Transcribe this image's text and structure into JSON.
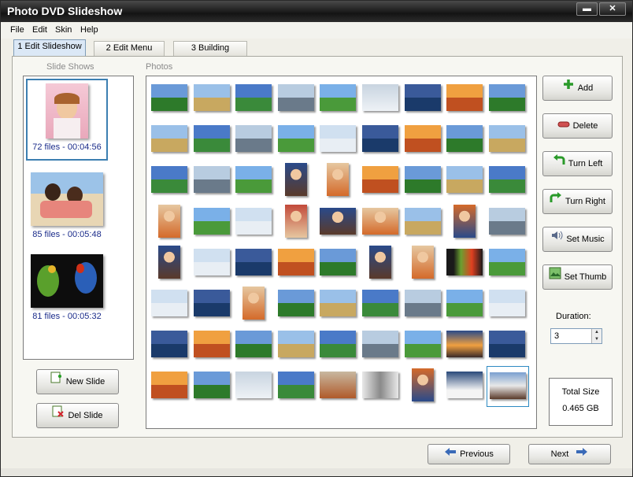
{
  "window": {
    "title": "Photo DVD Slideshow",
    "minimize": "▬",
    "close": "✕"
  },
  "menu": [
    "File",
    "Edit",
    "Skin",
    "Help"
  ],
  "tabs": [
    "1 Edit Slideshow",
    "2 Edit Menu",
    "3 Building"
  ],
  "slideshows": {
    "label": "Slide Shows",
    "items": [
      {
        "caption": "72 files - 00:04:56",
        "thumb": "girl-portrait"
      },
      {
        "caption": "85 files - 00:05:48",
        "thumb": "couple-on-beach"
      },
      {
        "caption": "81 files - 00:05:32",
        "thumb": "parrots"
      }
    ],
    "new_slide": "New Slide",
    "del_slide": "Del Slide"
  },
  "photos": {
    "label": "Photos",
    "selected_index": 71,
    "grid": [
      [
        "sky-horizon",
        "beach",
        "green-field",
        "bridge",
        "green-hill",
        "snow-scene",
        "savanna",
        "blue-sky-clouds",
        "lake-tree"
      ],
      [
        "mountain-valley",
        "clouds",
        "meadow",
        "tree-on-hill",
        "ocean",
        "lake-mountain",
        "mountain",
        "cliff",
        "dark-mountain"
      ],
      [
        "palm-beach",
        "misty-hills",
        "grass-field",
        "kids-portrait",
        "family-group",
        "green-valley",
        "lake-shore",
        "tree-field",
        "hazy-field"
      ],
      [
        "child-portrait",
        "forest",
        "tree",
        "child-standing",
        "kids-group",
        "kids-smiling",
        "lake",
        "person-portrait",
        "blue-sky"
      ],
      [
        "mother-child",
        "snowy-peak",
        "lake-mountain",
        "blue-lake",
        "horizon",
        "girl-portrait",
        "child-white",
        "parrot",
        "green-tree"
      ],
      [
        "garden",
        "people-walking",
        "girl-colorful",
        "waterfall",
        "river",
        "cloudy-sky",
        "tea-field",
        "green-terrace",
        "terrace"
      ],
      [
        "sky-clouds",
        "church",
        "clouds-field",
        "white-clouds",
        "wheat-field",
        "blue-sky-field",
        "grass-sky",
        "sunset",
        "blue-horizon"
      ],
      [
        "field-sky",
        "green-field",
        "fog",
        "blue-hills",
        "desert",
        "white-tiger",
        "woman-red",
        "swan",
        "eagle"
      ]
    ]
  },
  "actions": {
    "add": "Add",
    "delete": "Delete",
    "turn_left": "Turn Left",
    "turn_right": "Turn Right",
    "set_music": "Set Music",
    "set_thumb": "Set Thumb"
  },
  "duration": {
    "label": "Duration:",
    "value": "3"
  },
  "total": {
    "label": "Total Size",
    "value": "0.465 GB"
  },
  "nav": {
    "previous": "Previous",
    "next": "Next"
  }
}
